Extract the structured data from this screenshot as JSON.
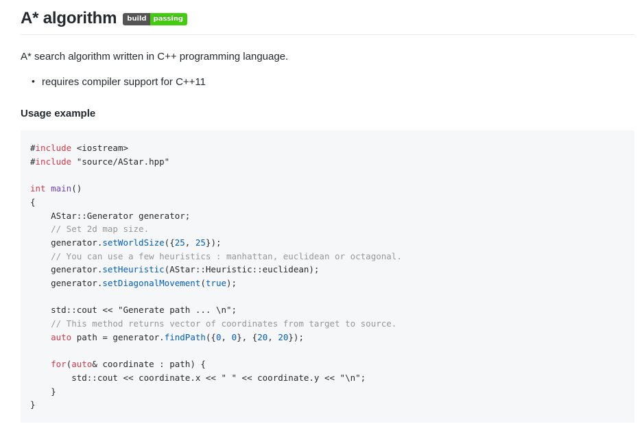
{
  "header": {
    "title": "A* algorithm",
    "badge": {
      "label": "build",
      "status": "passing",
      "label_color": "#555555",
      "status_color": "#44cc11"
    }
  },
  "body": {
    "intro": "A* search algorithm written in C++ programming language.",
    "features": [
      "requires compiler support for C++11"
    ],
    "section_heading": "Usage example"
  },
  "code": {
    "language": "cpp",
    "background": "#f6f7f8",
    "lines": [
      [
        {
          "t": "#",
          "c": "plain"
        },
        {
          "t": "include",
          "c": "kw"
        },
        {
          "t": " <iostream>",
          "c": "plain"
        }
      ],
      [
        {
          "t": "#",
          "c": "plain"
        },
        {
          "t": "include",
          "c": "kw"
        },
        {
          "t": " \"source/AStar.hpp\"",
          "c": "plain"
        }
      ],
      [],
      [
        {
          "t": "int",
          "c": "kw"
        },
        {
          "t": " ",
          "c": "plain"
        },
        {
          "t": "main",
          "c": "fn"
        },
        {
          "t": "()",
          "c": "plain"
        }
      ],
      [
        {
          "t": "{",
          "c": "plain"
        }
      ],
      [
        {
          "t": "    AStar::Generator generator;",
          "c": "plain"
        }
      ],
      [
        {
          "t": "    // Set 2d map size.",
          "c": "com"
        }
      ],
      [
        {
          "t": "    generator.",
          "c": "plain"
        },
        {
          "t": "setWorldSize",
          "c": "method"
        },
        {
          "t": "({",
          "c": "plain"
        },
        {
          "t": "25",
          "c": "num"
        },
        {
          "t": ", ",
          "c": "plain"
        },
        {
          "t": "25",
          "c": "num"
        },
        {
          "t": "});",
          "c": "plain"
        }
      ],
      [
        {
          "t": "    // You can use a few heuristics : manhattan, euclidean or octagonal.",
          "c": "com"
        }
      ],
      [
        {
          "t": "    generator.",
          "c": "plain"
        },
        {
          "t": "setHeuristic",
          "c": "method"
        },
        {
          "t": "(AStar::Heuristic::euclidean);",
          "c": "plain"
        }
      ],
      [
        {
          "t": "    generator.",
          "c": "plain"
        },
        {
          "t": "setDiagonalMovement",
          "c": "method"
        },
        {
          "t": "(",
          "c": "plain"
        },
        {
          "t": "true",
          "c": "const"
        },
        {
          "t": ");",
          "c": "plain"
        }
      ],
      [],
      [
        {
          "t": "    std::cout << ",
          "c": "plain"
        },
        {
          "t": "\"Generate path ... \\n\"",
          "c": "str"
        },
        {
          "t": ";",
          "c": "plain"
        }
      ],
      [
        {
          "t": "    // This method returns vector of coordinates from target to source.",
          "c": "com"
        }
      ],
      [
        {
          "t": "    ",
          "c": "plain"
        },
        {
          "t": "auto",
          "c": "kw"
        },
        {
          "t": " path = generator.",
          "c": "plain"
        },
        {
          "t": "findPath",
          "c": "method"
        },
        {
          "t": "({",
          "c": "plain"
        },
        {
          "t": "0",
          "c": "num"
        },
        {
          "t": ", ",
          "c": "plain"
        },
        {
          "t": "0",
          "c": "num"
        },
        {
          "t": "}, {",
          "c": "plain"
        },
        {
          "t": "20",
          "c": "num"
        },
        {
          "t": ", ",
          "c": "plain"
        },
        {
          "t": "20",
          "c": "num"
        },
        {
          "t": "});",
          "c": "plain"
        }
      ],
      [],
      [
        {
          "t": "    ",
          "c": "plain"
        },
        {
          "t": "for",
          "c": "kw"
        },
        {
          "t": "(",
          "c": "plain"
        },
        {
          "t": "auto",
          "c": "kw"
        },
        {
          "t": "& coordinate : path) {",
          "c": "plain"
        }
      ],
      [
        {
          "t": "        std::cout << coordinate.x << ",
          "c": "plain"
        },
        {
          "t": "\" \"",
          "c": "str"
        },
        {
          "t": " << coordinate.y << ",
          "c": "plain"
        },
        {
          "t": "\"\\n\"",
          "c": "str"
        },
        {
          "t": ";",
          "c": "plain"
        }
      ],
      [
        {
          "t": "    }",
          "c": "plain"
        }
      ],
      [
        {
          "t": "}",
          "c": "plain"
        }
      ]
    ]
  }
}
